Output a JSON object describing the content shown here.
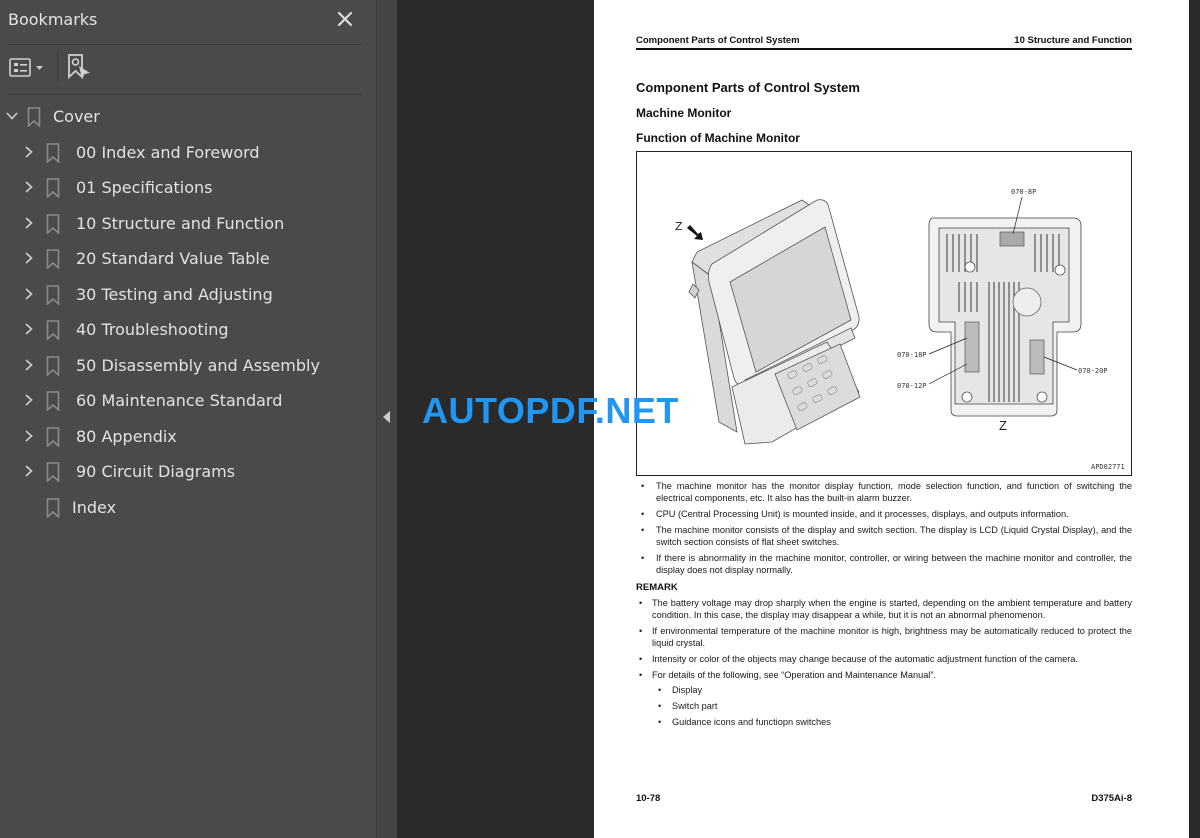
{
  "sidebar": {
    "title": "Bookmarks",
    "close_icon": "close-icon",
    "tools": [
      {
        "name": "bookmark-options",
        "icon": "list-options-icon"
      },
      {
        "name": "find-current-bookmark",
        "icon": "bookmark-locate-icon"
      }
    ],
    "items": [
      {
        "label": "Cover",
        "expanded": true,
        "level": 0,
        "has_children": true
      },
      {
        "label": "00 Index and Foreword",
        "expanded": false,
        "level": 1,
        "has_children": true
      },
      {
        "label": "01 Specifications",
        "expanded": false,
        "level": 1,
        "has_children": true
      },
      {
        "label": "10 Structure and Function",
        "expanded": false,
        "level": 1,
        "has_children": true
      },
      {
        "label": "20 Standard Value Table",
        "expanded": false,
        "level": 1,
        "has_children": true
      },
      {
        "label": "30 Testing and Adjusting",
        "expanded": false,
        "level": 1,
        "has_children": true
      },
      {
        "label": "40 Troubleshooting",
        "expanded": false,
        "level": 1,
        "has_children": true
      },
      {
        "label": "50 Disassembly and Assembly",
        "expanded": false,
        "level": 1,
        "has_children": true
      },
      {
        "label": "60 Maintenance Standard",
        "expanded": false,
        "level": 1,
        "has_children": true
      },
      {
        "label": "80 Appendix",
        "expanded": false,
        "level": 1,
        "has_children": true
      },
      {
        "label": "90 Circuit Diagrams",
        "expanded": false,
        "level": 1,
        "has_children": true
      },
      {
        "label": "Index",
        "expanded": false,
        "level": 1,
        "has_children": false
      }
    ]
  },
  "watermark": {
    "text": "AUTOPDF.NET",
    "color": "#2196f3"
  },
  "page": {
    "running_header_left": "Component Parts of Control System",
    "running_header_right": "10 Structure and Function",
    "heading1": "Component Parts of Control System",
    "heading2": "Machine Monitor",
    "heading3": "Function of Machine Monitor",
    "figure": {
      "view_label": "Z",
      "view_label_bottom": "Z",
      "connector_labels": [
        "070-8P",
        "070-18P",
        "070-12P",
        "070-20P"
      ],
      "figure_id": "APD02771"
    },
    "bullets": [
      "The machine monitor has the monitor display function, mode selection function, and function of switching the electrical components, etc. It also has the built-in alarm buzzer.",
      "CPU (Central Processing Unit) is mounted inside, and it processes, displays, and outputs information.",
      "The machine monitor consists of the display and switch section. The display is LCD (Liquid Crystal Display), and the switch section consists of flat sheet switches.",
      "If there is abnormality in the machine monitor, controller, or wiring between the machine monitor and controller, the display does not display normally."
    ],
    "remark_title": "REMARK",
    "remarks": [
      "The battery voltage may drop sharply when the engine is started, depending on the ambient temperature and battery condition. In this case, the display may disappear a while, but it is not an abnormal phenomenon.",
      "If environmental temperature of the machine monitor is high, brightness may be automatically reduced to protect the liquid crystal.",
      "Intensity or color of the objects may change because of the automatic adjustment function of the camera.",
      "For details of the following, see “Operation and Maintenance Manual”."
    ],
    "remark_subitems": [
      "Display",
      "Switch part",
      "Guidance icons and functiopn switches"
    ],
    "footer_left": "10-78",
    "footer_right": "D375Ai-8"
  }
}
